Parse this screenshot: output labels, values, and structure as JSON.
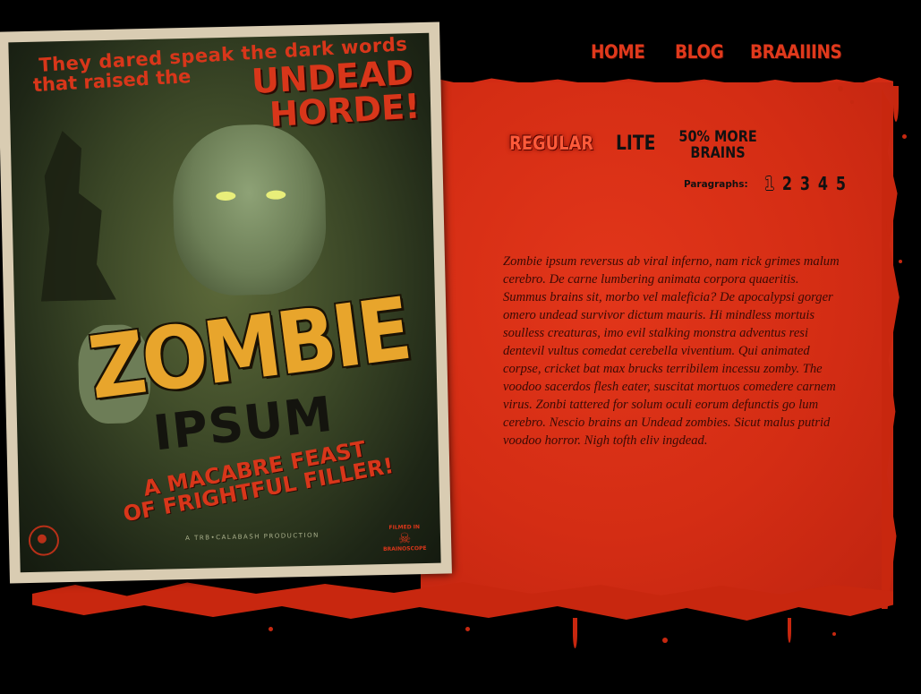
{
  "nav": {
    "items": [
      "HOME",
      "BLOG",
      "BRAAIIINS"
    ]
  },
  "variants": {
    "regular": "REGULAR",
    "lite": "LITE",
    "more_brains_line1": "50% MORE",
    "more_brains_line2": "BRAINS",
    "selected": "REGULAR"
  },
  "paragraphs": {
    "label": "Paragraphs:",
    "options": [
      "1",
      "2",
      "3",
      "4",
      "5"
    ],
    "selected": "1"
  },
  "content": {
    "text": "Zombie ipsum reversus ab viral inferno, nam rick grimes malum cerebro. De carne lumbering animata corpora quaeritis. Summus brains sit, morbo vel maleficia? De apocalypsi gorger omero undead survivor dictum mauris. Hi mindless mortuis soulless creaturas, imo evil stalking monstra adventus resi dentevil vultus comedat cerebella viventium. Qui animated corpse, cricket bat max brucks terribilem incessu zomby. The voodoo sacerdos flesh eater, suscitat mortuos comedere carnem virus. Zonbi tattered for solum oculi eorum defunctis go lum cerebro. Nescio brains an Undead zombies. Sicut malus putrid voodoo horror. Nigh tofth eliv ingdead."
  },
  "poster": {
    "headline_line1": "They dared speak the dark words",
    "headline_line2": "that raised the",
    "headline_big1": "UNDEAD",
    "headline_big2": "HORDE!",
    "title": "ZOMBIE",
    "subtitle": "IPSUM",
    "tagline_line1": "A MACABRE FEAST",
    "tagline_line2": "OF FRIGHTFUL FILLER!",
    "credit": "A TRB•CALABASH PRODUCTION",
    "filmed_line1": "FILMED IN",
    "filmed_line2": "BRAINOSCOPE"
  },
  "colors": {
    "panel_red": "#d42d14",
    "nav_red": "#e0391c",
    "background": "#000000"
  }
}
